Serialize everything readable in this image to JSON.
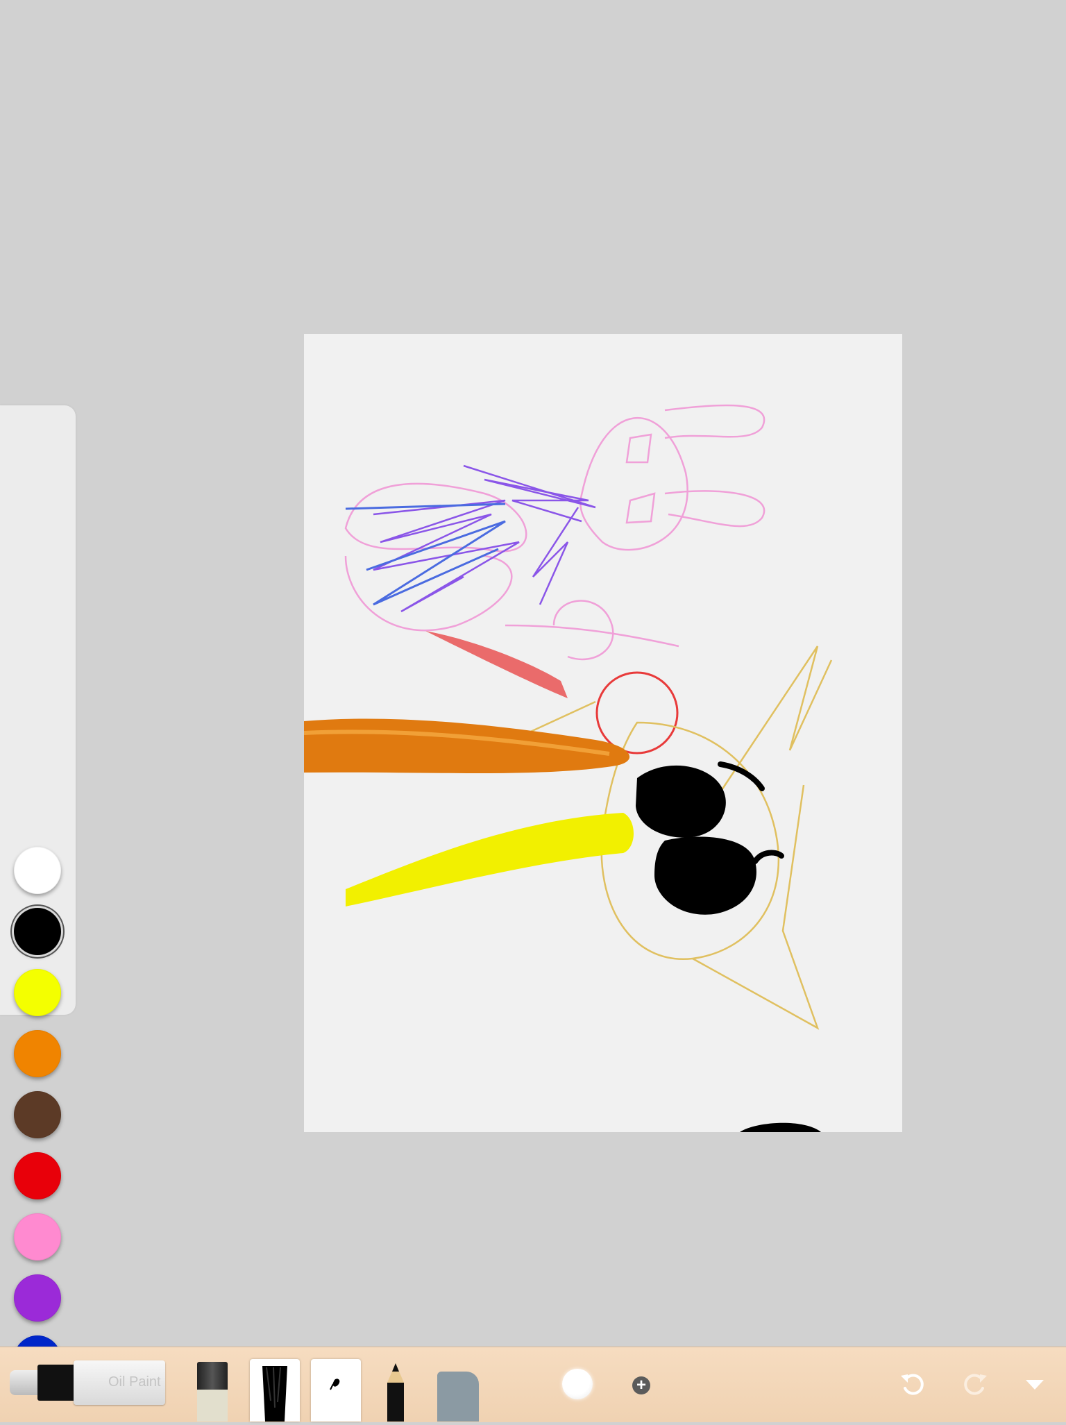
{
  "palette": {
    "swatches": [
      {
        "name": "white",
        "color": "#ffffff",
        "selected": false
      },
      {
        "name": "black",
        "color": "#000000",
        "selected": true
      },
      {
        "name": "yellow",
        "color": "#f4ff00",
        "selected": false
      },
      {
        "name": "orange",
        "color": "#f08400",
        "selected": false
      },
      {
        "name": "brown",
        "color": "#5c3a26",
        "selected": false
      },
      {
        "name": "red",
        "color": "#e8000a",
        "selected": false
      },
      {
        "name": "pink",
        "color": "#ff8ad0",
        "selected": false
      },
      {
        "name": "purple",
        "color": "#9b2ad8",
        "selected": false
      },
      {
        "name": "blue",
        "color": "#0026c9",
        "selected": false
      }
    ]
  },
  "toolbar": {
    "paint_label": "Oil Paint",
    "tools": [
      "paint-tube",
      "eraser-brush",
      "flat-brush",
      "small-brush",
      "pencil",
      "eraser"
    ],
    "accent": "#f3d7b8"
  },
  "canvas": {
    "background": "#f1f1f1"
  }
}
